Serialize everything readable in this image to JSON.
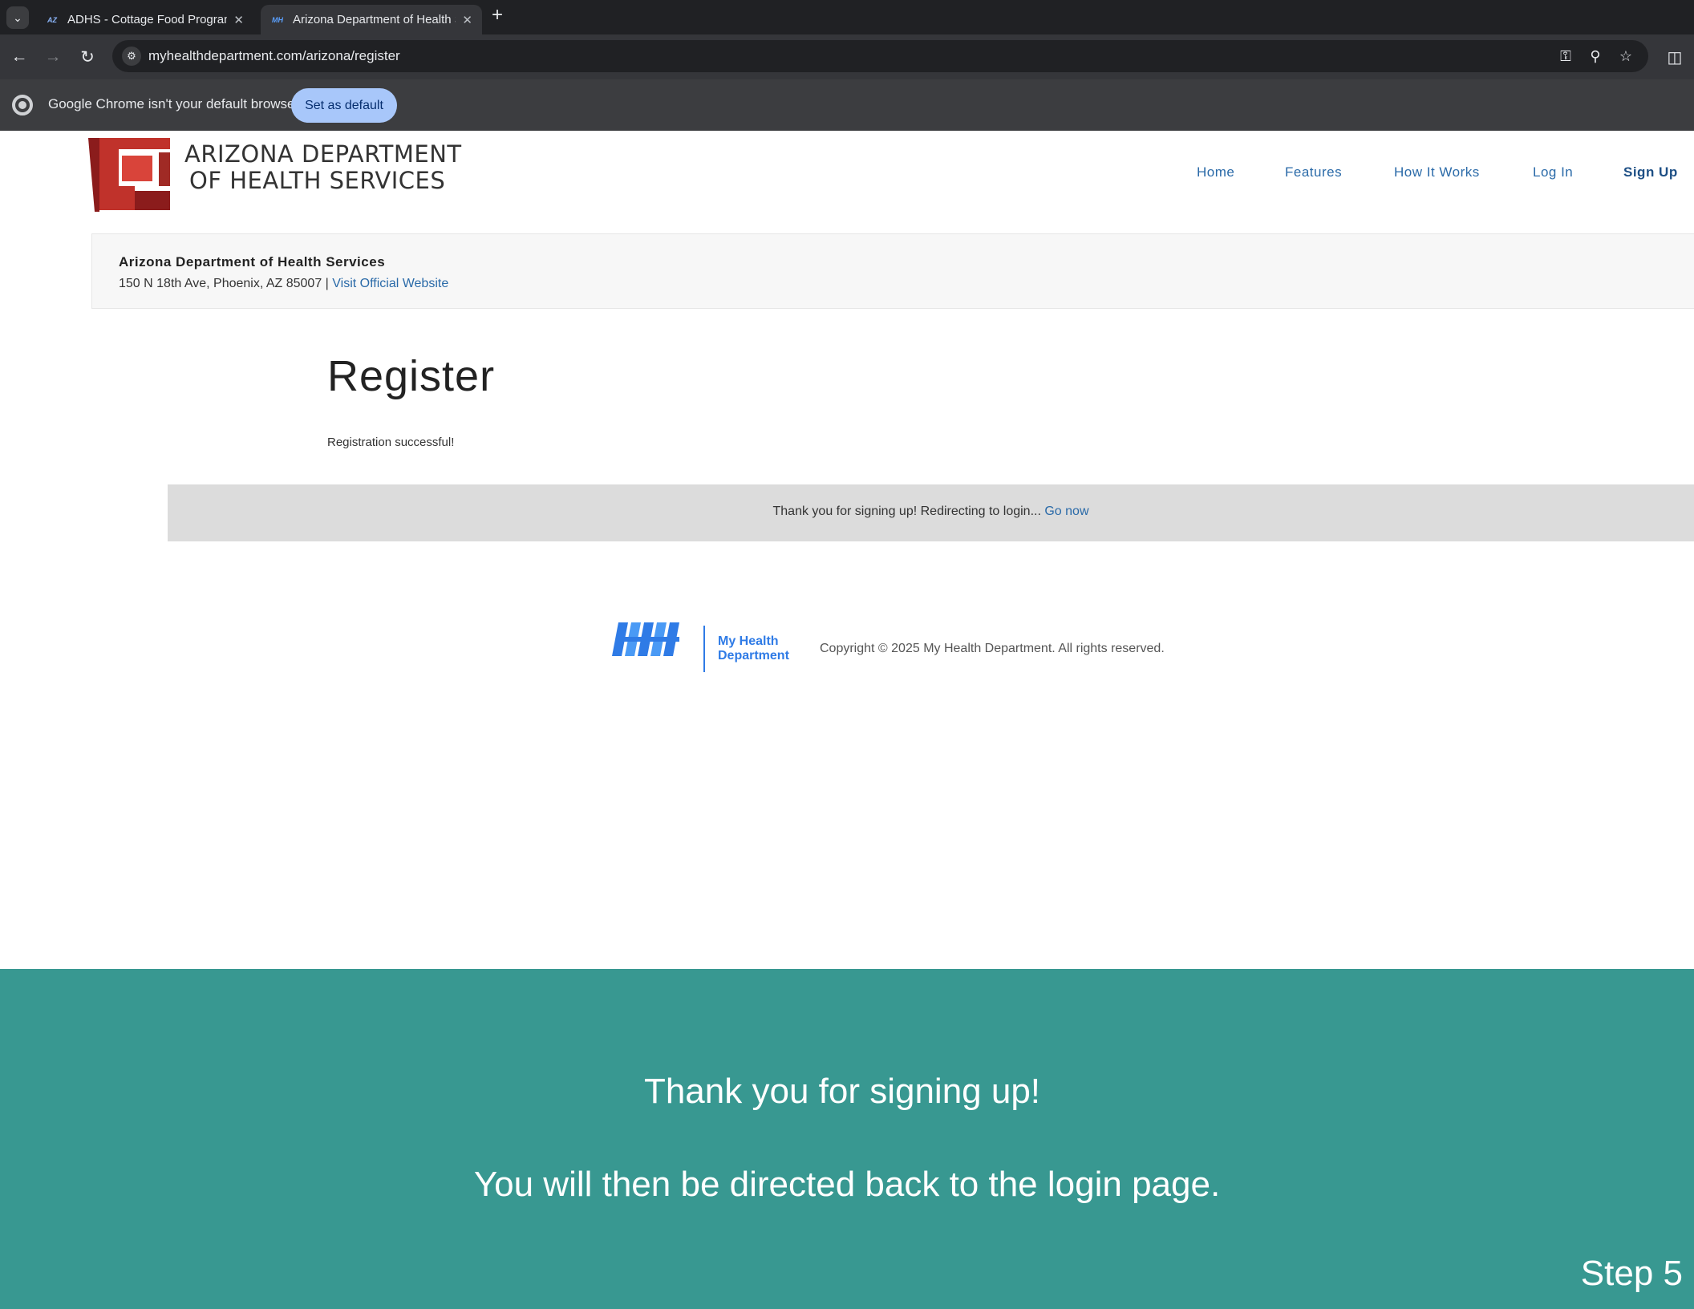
{
  "browser": {
    "tabs": [
      {
        "favicon": "AZ",
        "title": "ADHS - Cottage Food Program"
      },
      {
        "favicon": "MH",
        "title": "Arizona Department of Health S"
      }
    ],
    "url": "myhealthdepartment.com/arizona/register",
    "infobar": {
      "message": "Google Chrome isn't your default browser",
      "button": "Set as default"
    }
  },
  "site": {
    "logo_line1": "ARIZONA DEPARTMENT",
    "logo_line2": "OF HEALTH SERVICES",
    "nav": [
      "Home",
      "Features",
      "How It Works",
      "Log In",
      "Sign Up"
    ],
    "agency_name": "Arizona Department of Health Services",
    "agency_address": "150 N 18th Ave, Phoenix, AZ 85007 | ",
    "agency_link": "Visit Official Website"
  },
  "main": {
    "title": "Register",
    "status": "Registration successful!",
    "redirect_message": "Thank you for signing up! Redirecting to login... ",
    "redirect_link": "Go now"
  },
  "footer": {
    "brand_line1": "My Health",
    "brand_line2": "Department",
    "copyright": "Copyright © 2025 My Health Department. All rights reserved."
  },
  "caption": {
    "line1": "Thank you for signing up!",
    "line2": "You will then be directed back to the login page.",
    "step": "Step 5"
  },
  "colors": {
    "caption_bg": "#389891",
    "link": "#2a6aa8",
    "brand_blue": "#2f7be6",
    "adhs_red": "#c0322b"
  }
}
